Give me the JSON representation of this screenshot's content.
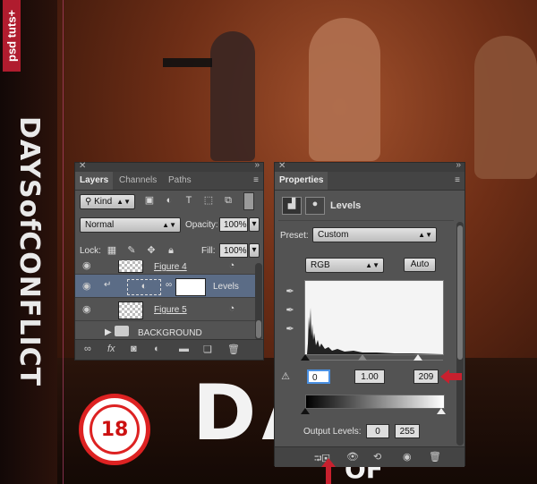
{
  "poster": {
    "brand": "psd tuts+",
    "title": "DAYSofCONFLICT",
    "rating": "18",
    "big_title": "DAYS",
    "sub_title": "OF"
  },
  "layers_panel": {
    "tabs": [
      "Layers",
      "Channels",
      "Paths"
    ],
    "filter_kind": "Kind",
    "blend_mode": "Normal",
    "opacity_label": "Opacity:",
    "opacity_value": "100%",
    "lock_label": "Lock:",
    "fill_label": "Fill:",
    "fill_value": "100%",
    "layers": [
      {
        "name": "Figure 4"
      },
      {
        "name": "Levels"
      },
      {
        "name": "Figure 5"
      },
      {
        "name": "BACKGROUND"
      }
    ]
  },
  "properties_panel": {
    "title": "Properties",
    "adjustment_name": "Levels",
    "preset_label": "Preset:",
    "preset_value": "Custom",
    "channel_value": "RGB",
    "auto_label": "Auto",
    "input_black": "0",
    "input_gamma": "1.00",
    "input_white": "209",
    "output_label": "Output Levels:",
    "output_black": "0",
    "output_white": "255"
  },
  "colors": {
    "accent_red": "#c8202e",
    "panel_bg": "#535353",
    "selected_row": "#5b6c86"
  }
}
